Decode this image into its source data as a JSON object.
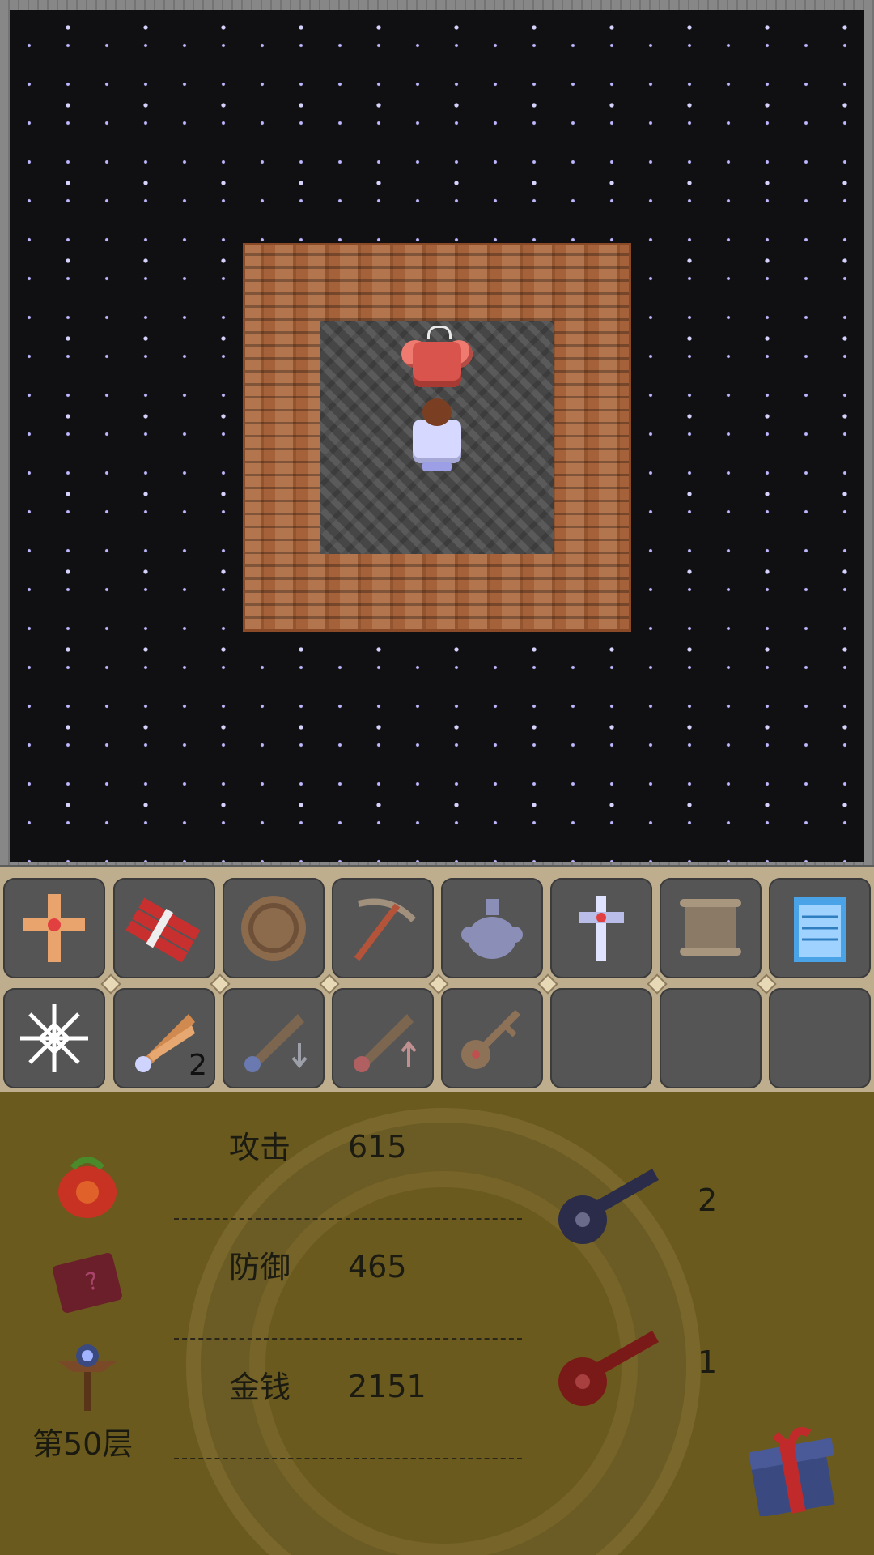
{
  "map": {
    "boss": "red-armored-knight",
    "hero": "hero-silver-armor"
  },
  "toolbar": {
    "items_row1": [
      {
        "name": "cross-icon"
      },
      {
        "name": "dynamite-icon"
      },
      {
        "name": "coin-icon"
      },
      {
        "name": "pickaxe-icon"
      },
      {
        "name": "holy-water-icon"
      },
      {
        "name": "sword-emblem-icon"
      },
      {
        "name": "scroll-icon"
      },
      {
        "name": "notepad-icon"
      }
    ],
    "items_row2": [
      {
        "name": "snowflake-icon"
      },
      {
        "name": "wing-icon",
        "count": "2"
      },
      {
        "name": "wing-down-icon"
      },
      {
        "name": "wing-up-icon"
      },
      {
        "name": "magic-key-icon"
      },
      {
        "name": "empty-slot"
      },
      {
        "name": "empty-slot"
      },
      {
        "name": "empty-slot"
      }
    ]
  },
  "status": {
    "floor": "第50层",
    "stats": [
      {
        "label": "攻击",
        "value": "615"
      },
      {
        "label": "防御",
        "value": "465"
      },
      {
        "label": "金钱",
        "value": "2151"
      }
    ],
    "keys": {
      "blue": "2",
      "red": "1"
    }
  },
  "colors": {
    "map_bg": "#101012",
    "wall": "#a4613a",
    "floor": "#505050",
    "slot": "#555555",
    "panel": "#6b5a1e"
  }
}
